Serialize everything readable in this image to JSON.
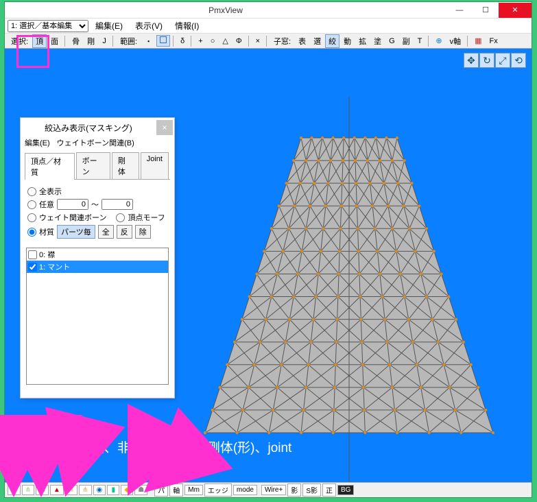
{
  "window": {
    "title": "PmxView"
  },
  "menubar": {
    "mode_select": "1: 選択／基本編集",
    "edit": "編集(E)",
    "view": "表示(V)",
    "info": "情報(I)"
  },
  "toolbar": {
    "select_label": "選択:",
    "vertex": "頂",
    "face": "面",
    "bone": "骨",
    "rigid": "剛",
    "joint": "J",
    "range_label": "範囲:",
    "dot": "・",
    "delta": "δ",
    "plus": "+",
    "circle": "○",
    "triangle": "△",
    "phi": "Φ",
    "x": "×",
    "child_label": "子窓:",
    "table": "表",
    "sel": "選",
    "mask": "絞",
    "move": "動",
    "expand": "拡",
    "paint": "塗",
    "g": "G",
    "sub": "副",
    "t": "T",
    "vaxis": "v軸",
    "fx": "Fx"
  },
  "masking": {
    "title": "絞込み表示(マスキング)",
    "menu_edit": "編集(E)",
    "menu_weight": "ウェイトボーン関連(B)",
    "tabs": {
      "vert_mat": "頂点／材質",
      "bone": "ボーン",
      "rigid": "剛体",
      "joint": "Joint"
    },
    "radio_all": "全表示",
    "radio_any": "任意",
    "any_from": "0",
    "any_tilde": "～",
    "any_to": "0",
    "radio_weight": "ウェイト関連ボーン",
    "radio_morph": "頂点モーフ",
    "radio_mat": "材質",
    "btn_parts": "パーツ毎",
    "btn_all": "全",
    "btn_inv": "反",
    "btn_del": "除",
    "items": [
      {
        "checked": false,
        "label": "0: 襟"
      },
      {
        "checked": true,
        "label": "1: マント"
      }
    ]
  },
  "annotation": "ボーン、選択頂点、非表示ボーン、剛体(形)、joint",
  "statusbar": {
    "pa": "パ",
    "axis": "軸",
    "mm": "Mm",
    "edge": "エッジ",
    "mode": "mode",
    "wire": "Wire+",
    "shadow": "影",
    "sshadow": "S影",
    "front": "正",
    "bg": "BG"
  }
}
